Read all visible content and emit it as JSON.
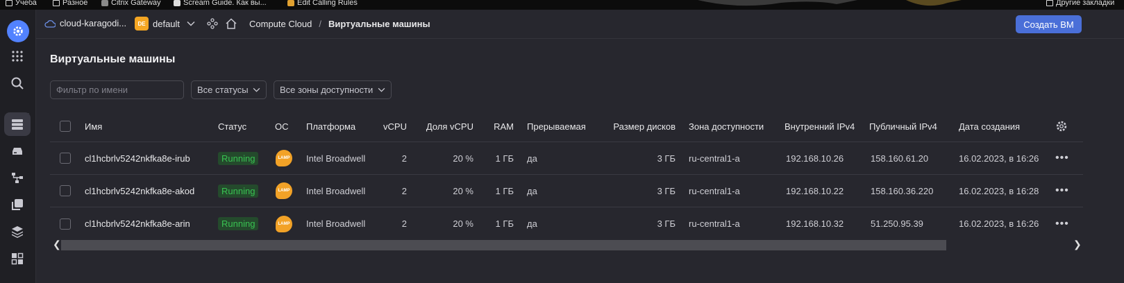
{
  "bookmarks": {
    "items": [
      {
        "label": "Учеба",
        "icon": "folder-icon"
      },
      {
        "label": "Разное",
        "icon": "folder-icon"
      },
      {
        "label": "Citrix Gateway",
        "icon": "citrix-icon"
      },
      {
        "label": "Scream Guide. Как вы...",
        "icon": "page-icon"
      },
      {
        "label": "Edit Calling Rules",
        "icon": "page-icon"
      }
    ],
    "other": "Другие закладки"
  },
  "sidebar": {
    "items": [
      {
        "name": "sidebar-item-services",
        "icon": "grid-icon"
      },
      {
        "name": "sidebar-item-search",
        "icon": "search-icon"
      },
      {
        "name": "sidebar-item-vms",
        "icon": "server-icon"
      },
      {
        "name": "sidebar-item-disks",
        "icon": "disk-icon"
      },
      {
        "name": "sidebar-item-placement-groups",
        "icon": "network-icon"
      },
      {
        "name": "sidebar-item-snapshots",
        "icon": "copy-icon"
      },
      {
        "name": "sidebar-item-images",
        "icon": "layers-icon"
      },
      {
        "name": "sidebar-item-instance-groups",
        "icon": "group-icon"
      }
    ]
  },
  "topbar": {
    "cloud": "cloud-karagodi...",
    "folder_badge": "DE",
    "folder": "default",
    "breadcrumb_service": "Compute Cloud",
    "breadcrumb_sep": "/",
    "breadcrumb_current": "Виртуальные машины",
    "create_button": "Создать ВМ"
  },
  "main": {
    "title": "Виртуальные машины",
    "filter_placeholder": "Фильтр по имени",
    "status_select": "Все статусы",
    "zone_select": "Все зоны доступности"
  },
  "table": {
    "headers": {
      "name": "Имя",
      "status": "Статус",
      "os": "ОС",
      "platform": "Платформа",
      "vcpu": "vCPU",
      "vcpu_share": "Доля vCPU",
      "ram": "RAM",
      "preemptible": "Прерываемая",
      "disk_size": "Размер дисков",
      "zone": "Зона доступности",
      "internal_ip": "Внутренний IPv4",
      "public_ip": "Публичный IPv4",
      "created": "Дата создания"
    },
    "rows": [
      {
        "name": "cl1hcbrlv5242nkfka8e-irub",
        "status": "Running",
        "os": "LAMP",
        "platform": "Intel Broadwell",
        "vcpu": "2",
        "vcpu_share": "20 %",
        "ram": "1 ГБ",
        "preemptible": "да",
        "disk_size": "3 ГБ",
        "zone": "ru-central1-a",
        "internal_ip": "192.168.10.26",
        "public_ip": "158.160.61.20",
        "created": "16.02.2023, в 16:26"
      },
      {
        "name": "cl1hcbrlv5242nkfka8e-akod",
        "status": "Running",
        "os": "LAMP",
        "platform": "Intel Broadwell",
        "vcpu": "2",
        "vcpu_share": "20 %",
        "ram": "1 ГБ",
        "preemptible": "да",
        "disk_size": "3 ГБ",
        "zone": "ru-central1-a",
        "internal_ip": "192.168.10.22",
        "public_ip": "158.160.36.220",
        "created": "16.02.2023, в 16:28"
      },
      {
        "name": "cl1hcbrlv5242nkfka8e-arin",
        "status": "Running",
        "os": "LAMP",
        "platform": "Intel Broadwell",
        "vcpu": "2",
        "vcpu_share": "20 %",
        "ram": "1 ГБ",
        "preemptible": "да",
        "disk_size": "3 ГБ",
        "zone": "ru-central1-a",
        "internal_ip": "192.168.10.32",
        "public_ip": "51.250.95.39",
        "created": "16.02.2023, в 16:26"
      }
    ],
    "row_menu": "•••"
  },
  "colors": {
    "accent": "#4a6fd8",
    "running_bg": "#244a2c",
    "running_text": "#39c252",
    "lamp": "#f2a227",
    "folder_badge": "#f5a623"
  }
}
